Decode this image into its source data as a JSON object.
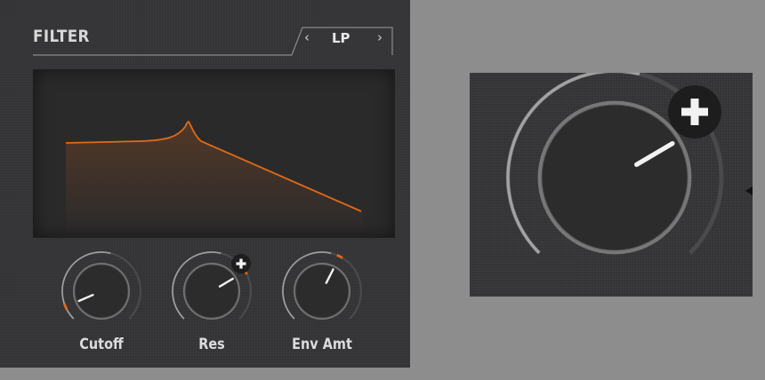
{
  "filter": {
    "title": "FILTER",
    "mode": {
      "value": "LP",
      "prev_icon": "chevron-left-icon",
      "next_icon": "chevron-right-icon"
    },
    "display": {
      "curve_color": "#e06a18"
    },
    "knobs": [
      {
        "id": "cutoff",
        "label": "Cutoff",
        "value": 0.08,
        "modulated": false
      },
      {
        "id": "res",
        "label": "Res",
        "value": 0.72,
        "modulated": true,
        "mod_icon": "plus-icon"
      },
      {
        "id": "env-amt",
        "label": "Env Amt",
        "value": 0.6,
        "modulated": false
      }
    ]
  },
  "zoom": {
    "knob_value": 0.72,
    "icon": "plus-icon"
  },
  "colors": {
    "accent": "#e06a18",
    "panel": "#333335",
    "background": "#8d8d8d",
    "text": "#dcdcdc"
  }
}
